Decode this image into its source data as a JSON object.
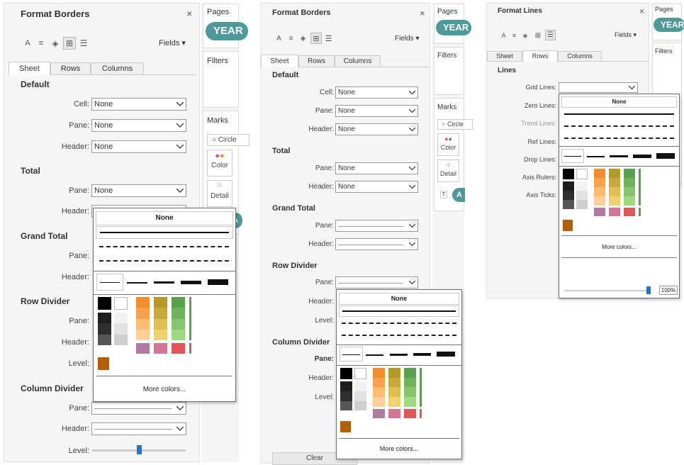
{
  "icons": [
    "font-icon",
    "align-icon",
    "shading-icon",
    "borders-icon",
    "lines-icon"
  ],
  "p1": {
    "title": "Format Borders",
    "fields": "Fields ▾",
    "tabs": [
      "Sheet",
      "Rows",
      "Columns"
    ],
    "sections": {
      "default": "Default",
      "total": "Total",
      "grand_total": "Grand Total",
      "row_divider": "Row Divider",
      "column_divider": "Column Divider"
    },
    "labels": {
      "cell": "Cell:",
      "pane": "Pane:",
      "header": "Header:",
      "level": "Level:"
    },
    "values": {
      "cell": "None",
      "pane": "None",
      "header": "None",
      "total_pane": "None"
    },
    "popup": {
      "none": "None",
      "more": "More colors..."
    },
    "side": {
      "pages": "Pages",
      "pill": "YEAR",
      "filters": "Filters",
      "marks": "Marks",
      "circle": "Circle",
      "color": "Color",
      "detail": "Detail"
    }
  },
  "p2": {
    "title": "Format Borders",
    "fields": "Fields ▾",
    "tabs": [
      "Sheet",
      "Rows",
      "Columns"
    ],
    "sections": {
      "default": "Default",
      "total": "Total",
      "grand_total": "Grand Total",
      "row_divider": "Row Divider",
      "column_divider": "Column Divider"
    },
    "labels": {
      "cell": "Cell:",
      "pane": "Pane:",
      "header": "Header:",
      "level": "Level:"
    },
    "values": {
      "cell": "None",
      "pane": "None",
      "header": "None",
      "total_pane": "None",
      "total_header": "None"
    },
    "popup": {
      "none": "None",
      "more": "More colors..."
    },
    "bottom": "Clear",
    "side": {
      "pages": "Pages",
      "pill": "YEAR",
      "filters": "Filters",
      "marks": "Marks",
      "circle": "Circle",
      "color": "Color",
      "detail": "Detail",
      "t": "T"
    }
  },
  "p3": {
    "title": "Format Lines",
    "fields": "Fields ▾",
    "tabs": [
      "Sheet",
      "Rows",
      "Columns"
    ],
    "section": "Lines",
    "labels": {
      "grid": "Grid Lines:",
      "zero": "Zero Lines:",
      "trend": "Trend Lines:",
      "ref": "Ref Lines:",
      "drop": "Drop Lines:",
      "rulers": "Axis Rulers:",
      "ticks": "Axis Ticks:"
    },
    "popup": {
      "none": "None",
      "more": "More colors...",
      "opacity": "100%"
    },
    "side": {
      "pages": "Pages",
      "pill": "YEAR",
      "filters": "Filters"
    }
  },
  "colors": {
    "accent": "#1f77c9",
    "pill": "#4e9a9a",
    "grays": [
      "#000000",
      "#1e1e1e",
      "#2e2e2e",
      "#555555",
      "#ffffff",
      "#f2f2f2",
      "#e2e2e2",
      "#cfcfcf"
    ],
    "orange": [
      "#f28e2b",
      "#f8a24e",
      "#ffbb6f",
      "#ffcf99"
    ],
    "olive": [
      "#b59b23",
      "#c9a93c",
      "#e0bf4f",
      "#f0d16a"
    ],
    "green": [
      "#59a14f",
      "#71b35d",
      "#86c46d",
      "#9fd87f"
    ],
    "bottom_row": [
      "#b07aa1",
      "#d57596",
      "#e15759"
    ],
    "recent": "#b45f06"
  }
}
